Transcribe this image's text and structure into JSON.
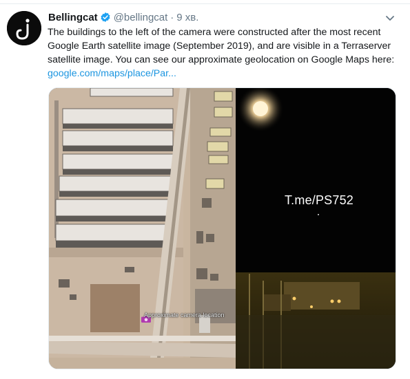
{
  "tweet": {
    "display_name": "Bellingcat",
    "handle": "@bellingcat",
    "separator": "·",
    "time": "9 хв.",
    "text": "The buildings to the left of the camera were constructed after the most recent Google Earth satellite image (September 2019), and are visible in a Terraserver satellite image. You can see our approximate geolocation on Google Maps here:",
    "link_text": "google.com/maps/place/Par...",
    "icons": {
      "avatar": "bellingcat-logo-icon",
      "verified": "verified-badge-icon",
      "menu": "chevron-down-icon",
      "camera": "camera-icon"
    }
  },
  "media": {
    "left_image_label": "Approximate camera location",
    "right_image_overlay": "T.me/PS752"
  },
  "colors": {
    "link": "#1b95e0",
    "verified": "#1da1f2",
    "secondary": "#657786"
  }
}
